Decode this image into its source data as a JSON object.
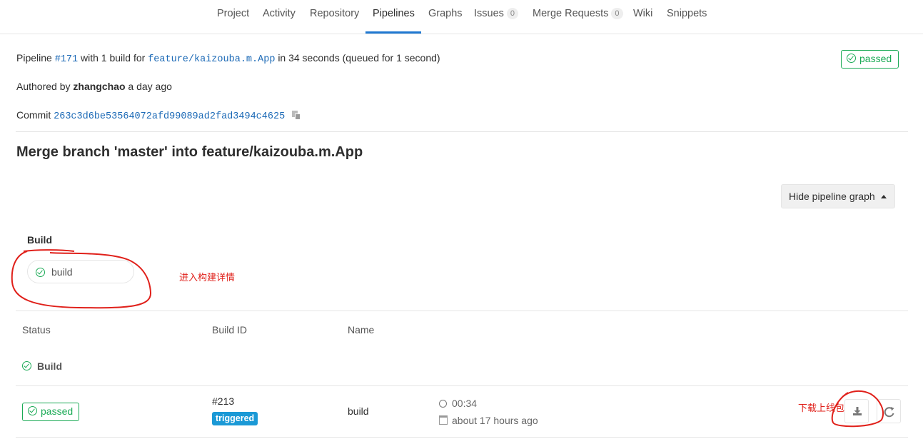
{
  "nav": {
    "items": [
      {
        "label": "Project"
      },
      {
        "label": "Activity"
      },
      {
        "label": "Repository"
      },
      {
        "label": "Pipelines"
      },
      {
        "label": "Graphs"
      },
      {
        "label": "Issues",
        "count": "0"
      },
      {
        "label": "Merge Requests",
        "count": "0"
      },
      {
        "label": "Wiki"
      },
      {
        "label": "Snippets"
      }
    ],
    "active": "Pipelines"
  },
  "pipeline": {
    "prefix": "Pipeline",
    "id": "#171",
    "with_text": "with 1 build for",
    "branch": "feature/kaizouba.m.App",
    "duration_text": "in 34 seconds (queued for 1 second)",
    "status": "passed"
  },
  "author": {
    "prefix": "Authored by",
    "name": "zhangchao",
    "time": "a day ago"
  },
  "commit": {
    "prefix": "Commit",
    "sha": "263c3d6be53564072afd99089ad2fad3494c4625"
  },
  "title": "Merge branch 'master' into feature/kaizouba.m.App",
  "graph": {
    "hide_button": "Hide pipeline graph",
    "stage_title": "Build",
    "job_name": "build"
  },
  "annotations": {
    "enter_details": "进入构建详情",
    "download_package": "下载上线包"
  },
  "table": {
    "headers": {
      "status": "Status",
      "build_id": "Build ID",
      "name": "Name"
    },
    "stage_row": "Build",
    "rows": [
      {
        "status": "passed",
        "build_id": "#213",
        "tag": "triggered",
        "name": "build",
        "duration": "00:34",
        "finished": "about 17 hours ago"
      }
    ]
  },
  "colors": {
    "success": "#1aaa55",
    "link": "#1b69b6",
    "active_tab": "#1f78d1",
    "annotation_red": "#e0201a",
    "triggered_badge": "#1b99d6"
  }
}
